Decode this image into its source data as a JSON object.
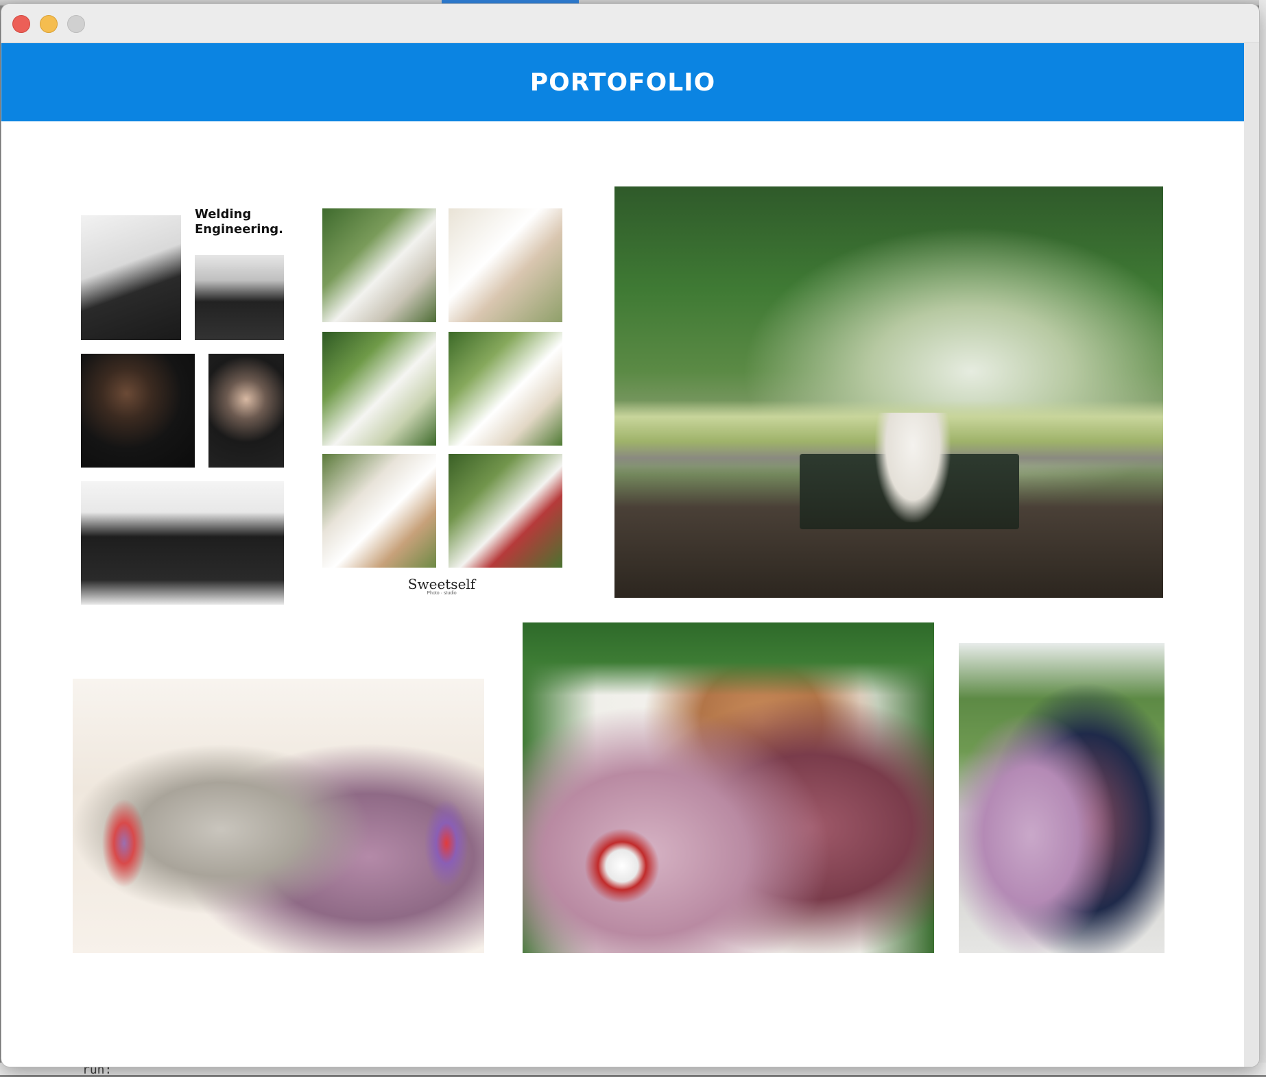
{
  "window": {
    "traffic_lights": [
      "close",
      "minimize",
      "maximize"
    ]
  },
  "header": {
    "title": "PORTOFOLIO",
    "color": "#0b84e2"
  },
  "gallery": {
    "collage_welding": {
      "label_line1": "Welding",
      "label_line2": "Engineering."
    },
    "collage_sweetself": {
      "logo_text": "Sweetself",
      "logo_sub": "Photo · studio"
    }
  },
  "background": {
    "terminal_text": "run:"
  }
}
